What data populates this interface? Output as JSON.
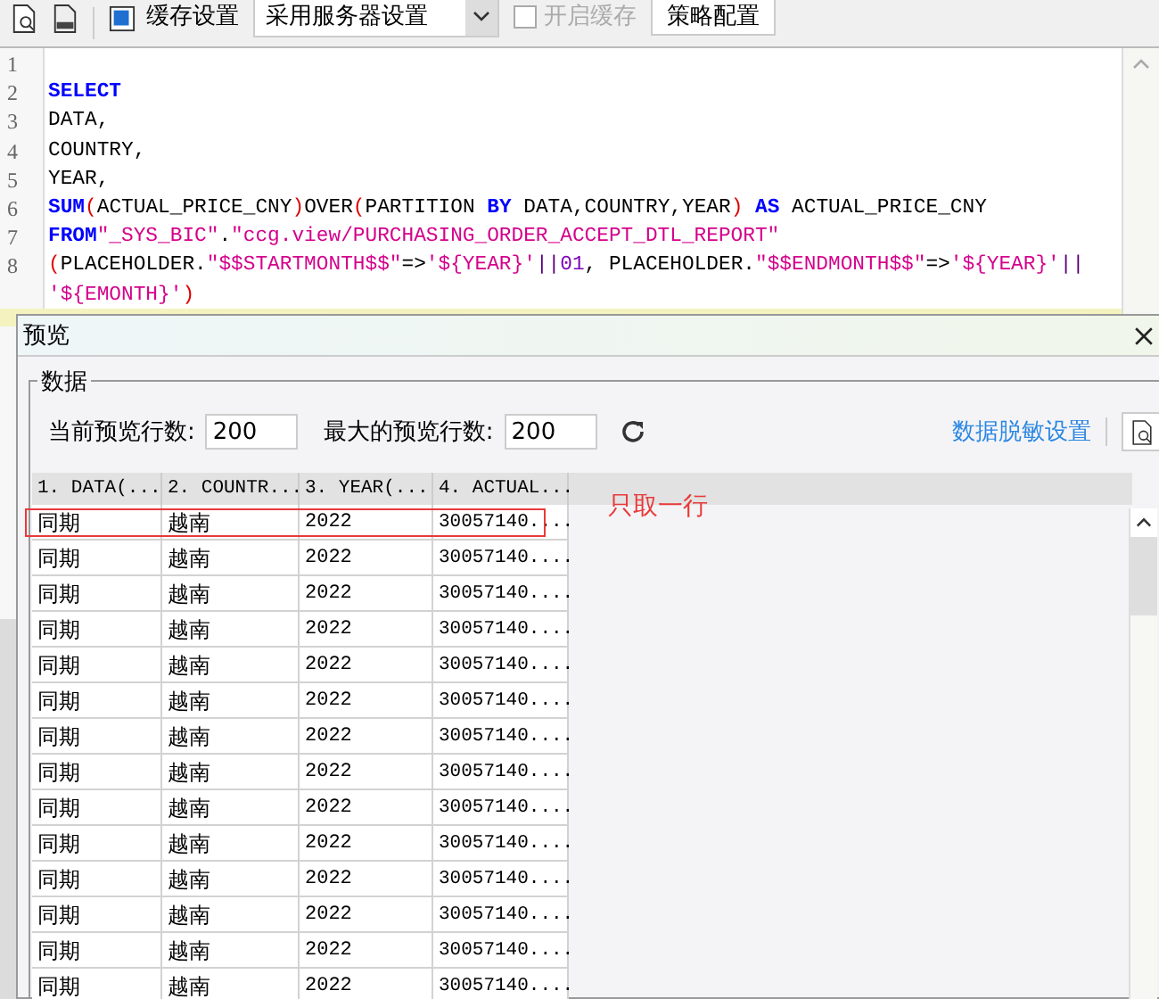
{
  "toolbar": {
    "cache_label": "缓存设置",
    "cache_select": {
      "value": "采用服务器设置"
    },
    "enable_cache": {
      "label": "开启缓存",
      "checked": false,
      "disabled": true
    },
    "strategy_button": "策略配置"
  },
  "editor": {
    "lines": [
      {
        "number": "1"
      },
      {
        "number": "2",
        "segments": [
          {
            "kind": "keyword",
            "text": "SELECT"
          }
        ]
      },
      {
        "number": "3",
        "segments": [
          {
            "kind": "plain",
            "text": "DATA,"
          }
        ]
      },
      {
        "number": "4",
        "segments": [
          {
            "kind": "plain",
            "text": "COUNTRY,"
          }
        ]
      },
      {
        "number": "5",
        "segments": [
          {
            "kind": "plain",
            "text": "YEAR,"
          }
        ]
      },
      {
        "number": "6",
        "segments": [
          {
            "kind": "keyword",
            "text": "SUM"
          },
          {
            "kind": "paren",
            "text": "("
          },
          {
            "kind": "plain",
            "text": "ACTUAL_PRICE_CNY"
          },
          {
            "kind": "paren",
            "text": ")"
          },
          {
            "kind": "plain",
            "text": "OVER"
          },
          {
            "kind": "paren",
            "text": "("
          },
          {
            "kind": "plain",
            "text": "PARTITION "
          },
          {
            "kind": "keyword",
            "text": "BY"
          },
          {
            "kind": "plain",
            "text": " DATA,COUNTRY,YEAR"
          },
          {
            "kind": "paren",
            "text": ")"
          },
          {
            "kind": "keyword",
            "text": " AS"
          },
          {
            "kind": "plain",
            "text": " ACTUAL_PRICE_CNY"
          }
        ]
      },
      {
        "number": "7",
        "segments": [
          {
            "kind": "keyword",
            "text": "FROM"
          },
          {
            "kind": "string",
            "text": "\"_SYS_BIC\""
          },
          {
            "kind": "plain",
            "text": "."
          },
          {
            "kind": "string",
            "text": "\"ccg.view/PURCHASING_ORDER_ACCEPT_DTL_REPORT\""
          }
        ]
      },
      {
        "number": "8",
        "segments": [
          {
            "kind": "paren",
            "text": "("
          },
          {
            "kind": "plain",
            "text": "PLACEHOLDER."
          },
          {
            "kind": "string",
            "text": "\"$$STARTMONTH$$\""
          },
          {
            "kind": "plain",
            "text": "=>"
          },
          {
            "kind": "string",
            "text": "'${YEAR}'"
          },
          {
            "kind": "operator",
            "text": "||"
          },
          {
            "kind": "number",
            "text": "01"
          },
          {
            "kind": "plain",
            "text": ", PLACEHOLDER."
          },
          {
            "kind": "string",
            "text": "\"$$ENDMONTH$$\""
          },
          {
            "kind": "plain",
            "text": "=>"
          },
          {
            "kind": "string",
            "text": "'${YEAR}'"
          },
          {
            "kind": "operator",
            "text": "||"
          }
        ]
      },
      {
        "segments": [
          {
            "kind": "string",
            "text": "'${EMONTH}'"
          },
          {
            "kind": "paren",
            "text": ")"
          }
        ]
      }
    ]
  },
  "preview": {
    "title": "预览",
    "group_label": "数据",
    "current_rows_label": "当前预览行数:",
    "current_rows_value": "200",
    "max_rows_label": "最大的预览行数:",
    "max_rows_value": "200",
    "masking_link": "数据脱敏设置",
    "table": {
      "columns": [
        "1. DATA(...",
        "2. COUNTR...",
        "3. YEAR(...",
        "4. ACTUAL..."
      ],
      "rows": [
        {
          "marked": true,
          "cells": [
            "同期",
            "越南",
            "2022",
            "30057140...."
          ]
        },
        {
          "marked": false,
          "cells": [
            "同期",
            "越南",
            "2022",
            "30057140...."
          ]
        },
        {
          "marked": false,
          "cells": [
            "同期",
            "越南",
            "2022",
            "30057140...."
          ]
        },
        {
          "marked": false,
          "cells": [
            "同期",
            "越南",
            "2022",
            "30057140...."
          ]
        },
        {
          "marked": false,
          "cells": [
            "同期",
            "越南",
            "2022",
            "30057140...."
          ]
        },
        {
          "marked": false,
          "cells": [
            "同期",
            "越南",
            "2022",
            "30057140...."
          ]
        },
        {
          "marked": false,
          "cells": [
            "同期",
            "越南",
            "2022",
            "30057140...."
          ]
        },
        {
          "marked": false,
          "cells": [
            "同期",
            "越南",
            "2022",
            "30057140...."
          ]
        },
        {
          "marked": false,
          "cells": [
            "同期",
            "越南",
            "2022",
            "30057140...."
          ]
        },
        {
          "marked": false,
          "cells": [
            "同期",
            "越南",
            "2022",
            "30057140...."
          ]
        },
        {
          "marked": false,
          "cells": [
            "同期",
            "越南",
            "2022",
            "30057140...."
          ]
        },
        {
          "marked": false,
          "cells": [
            "同期",
            "越南",
            "2022",
            "30057140...."
          ]
        },
        {
          "marked": false,
          "cells": [
            "同期",
            "越南",
            "2022",
            "30057140...."
          ]
        },
        {
          "marked": false,
          "cells": [
            "同期",
            "越南",
            "2022",
            "30057140...."
          ]
        }
      ]
    },
    "annotation": "只取一行"
  }
}
